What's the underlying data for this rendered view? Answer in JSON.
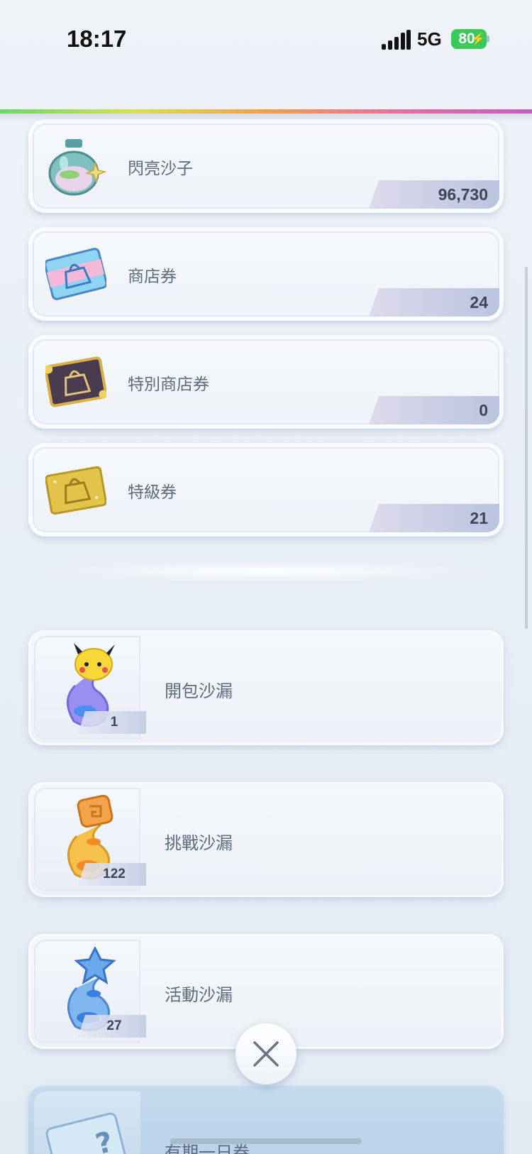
{
  "status_bar": {
    "time": "18:17",
    "network": "5G",
    "battery": "80"
  },
  "currencies": [
    {
      "label": "閃亮沙子",
      "value": "96,730",
      "icon": "shiny-sand-bottle-icon"
    },
    {
      "label": "商店券",
      "value": "24",
      "icon": "shop-ticket-icon"
    },
    {
      "label": "特別商店券",
      "value": "0",
      "icon": "special-shop-ticket-icon"
    },
    {
      "label": "特級券",
      "value": "21",
      "icon": "premium-ticket-icon"
    }
  ],
  "hourglasses": [
    {
      "label": "開包沙漏",
      "count": "1",
      "icon": "pack-hourglass-icon"
    },
    {
      "label": "挑戰沙漏",
      "count": "122",
      "icon": "challenge-hourglass-icon"
    },
    {
      "label": "活動沙漏",
      "count": "27",
      "icon": "event-hourglass-icon"
    }
  ],
  "partial_item": {
    "label": "有期一日券",
    "icon": "ticket-icon"
  },
  "colors": {
    "accent": "#3cc95c",
    "card": "#f2f5f9",
    "value_badge": "#b9c4de"
  }
}
